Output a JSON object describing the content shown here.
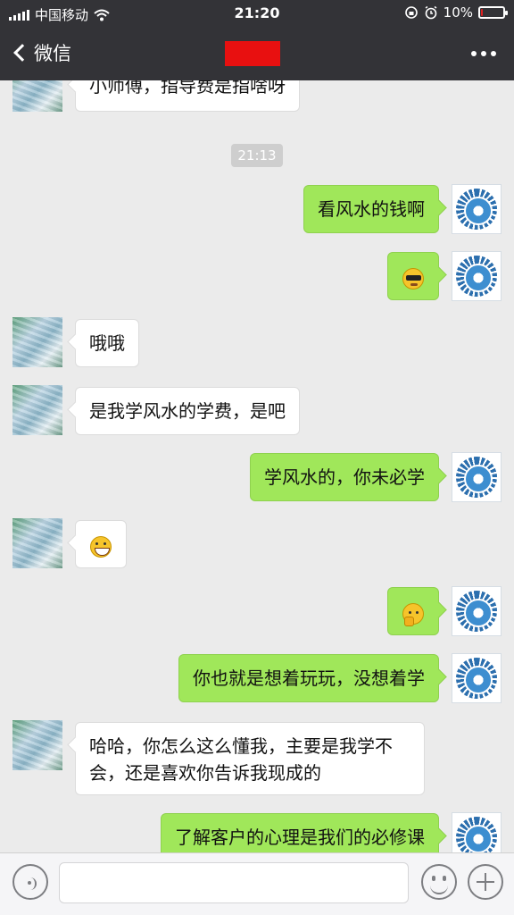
{
  "status_bar": {
    "carrier": "中国移动",
    "time": "21:20",
    "battery": "10%",
    "battery_level": 0.1,
    "icons": [
      "signal-icon",
      "wifi-icon",
      "rotation-lock-icon",
      "alarm-icon",
      "battery-icon"
    ]
  },
  "nav": {
    "back_label": "微信",
    "title_redacted": true,
    "more_icon": "more-dots-icon"
  },
  "chat": {
    "timestamp": "21:13",
    "messages": [
      {
        "side": "in",
        "text": "小师傅，指导费是指啥呀"
      },
      {
        "side": "out",
        "text": "看风水的钱啊"
      },
      {
        "side": "out",
        "emoji": "cool-emoji-icon"
      },
      {
        "side": "in",
        "text": "哦哦"
      },
      {
        "side": "in",
        "text": "是我学风水的学费，是吧"
      },
      {
        "side": "out",
        "text": "学风水的，你未必学"
      },
      {
        "side": "in",
        "emoji": "grin-emoji-icon"
      },
      {
        "side": "out",
        "emoji": "thinking-emoji-icon"
      },
      {
        "side": "out",
        "text": "你也就是想着玩玩，没想着学"
      },
      {
        "side": "in",
        "text": "哈哈，你怎么这么懂我，主要是我学不会，还是喜欢你告诉我现成的"
      },
      {
        "side": "out",
        "text": "了解客户的心理是我们的必修课"
      }
    ]
  },
  "input_bar": {
    "voice_icon": "voice-icon",
    "emoji_icon": "emoji-icon",
    "plus_icon": "plus-icon",
    "input_value": ""
  }
}
